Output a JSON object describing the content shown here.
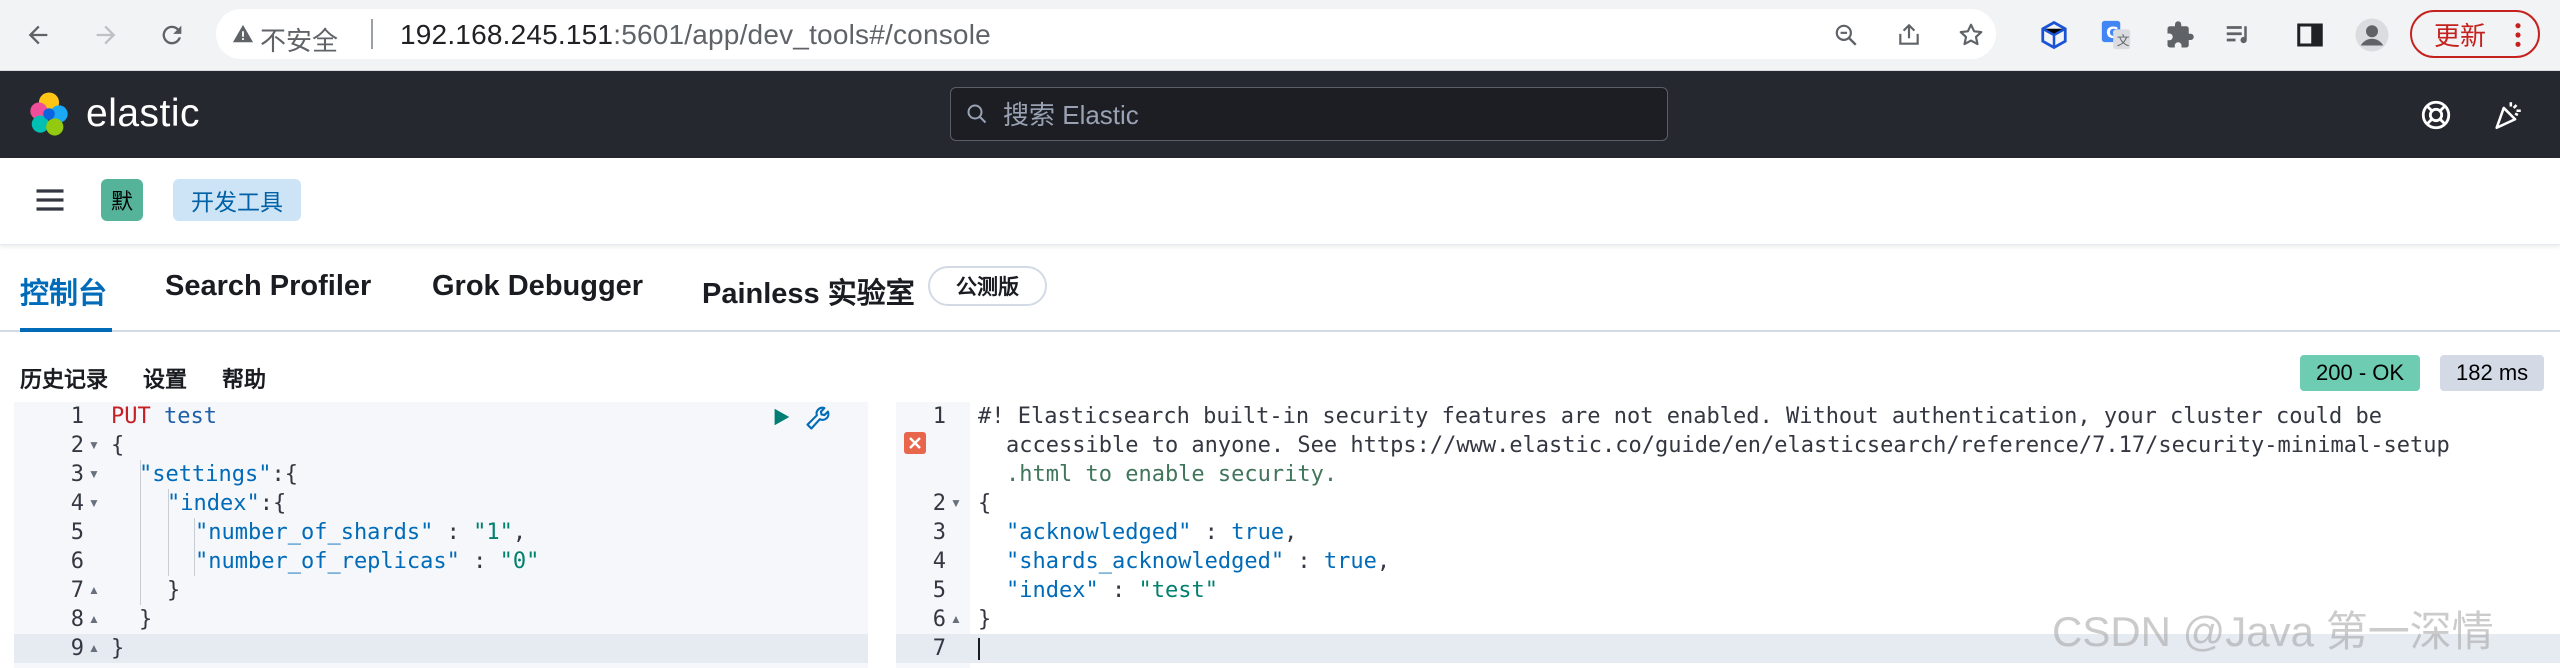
{
  "browser": {
    "security_label": "不安全",
    "url_host": "192.168.245.151",
    "url_rest": ":5601/app/dev_tools#/console",
    "update_label": "更新"
  },
  "header": {
    "brand": "elastic",
    "search_placeholder": "搜索 Elastic"
  },
  "subbar": {
    "space_initial": "默",
    "breadcrumb": "开发工具"
  },
  "tabs": [
    {
      "label": "控制台",
      "active": true
    },
    {
      "label": "Search Profiler",
      "active": false
    },
    {
      "label": "Grok Debugger",
      "active": false
    },
    {
      "label": "Painless 实验室",
      "active": false
    }
  ],
  "beta_badge": "公测版",
  "console_menu": {
    "history": "历史记录",
    "settings": "设置",
    "help": "帮助"
  },
  "response_status": "200 - OK",
  "response_time": "182 ms",
  "request_editor": {
    "lines": [
      "1",
      "2",
      "3",
      "4",
      "5",
      "6",
      "7",
      "8",
      "9"
    ],
    "method": "PUT",
    "path": "test",
    "open_brace": "{",
    "settings_key": "\"settings\"",
    "settings_tail": ":{",
    "index_key": "\"index\"",
    "index_tail": ":{",
    "shards_key": "\"number_of_shards\"",
    "shards_sep": " : ",
    "shards_val": "\"1\"",
    "shards_comma": ",",
    "replicas_key": "\"number_of_replicas\"",
    "replicas_sep": " : ",
    "replicas_val": "\"0\"",
    "close_brace": "}"
  },
  "response_editor": {
    "lines": [
      "1",
      "2",
      "3",
      "4",
      "5",
      "6",
      "7"
    ],
    "warning_1": "#! Elasticsearch built-in security features are not enabled. Without authentication, your cluster could be",
    "warning_2": "accessible to anyone. See https://www.elastic.co/guide/en/elasticsearch/reference/7.17/security-minimal-setup",
    "warning_3": ".html to enable security.",
    "open_brace": "{",
    "ack_key": "\"acknowledged\"",
    "ack_sep": " : ",
    "ack_val": "true",
    "ack_comma": ",",
    "shards_ack_key": "\"shards_acknowledged\"",
    "shards_ack_sep": " : ",
    "shards_ack_val": "true",
    "shards_ack_comma": ",",
    "index_key": "\"index\"",
    "index_sep": " : ",
    "index_val": "\"test\"",
    "close_brace": "}"
  },
  "watermark": "CSDN @Java 第一深情",
  "colors": {
    "accent": "#006bb8",
    "header_bg": "#25282f",
    "status_ok": "#6dccb1",
    "error": "#e7664c"
  }
}
